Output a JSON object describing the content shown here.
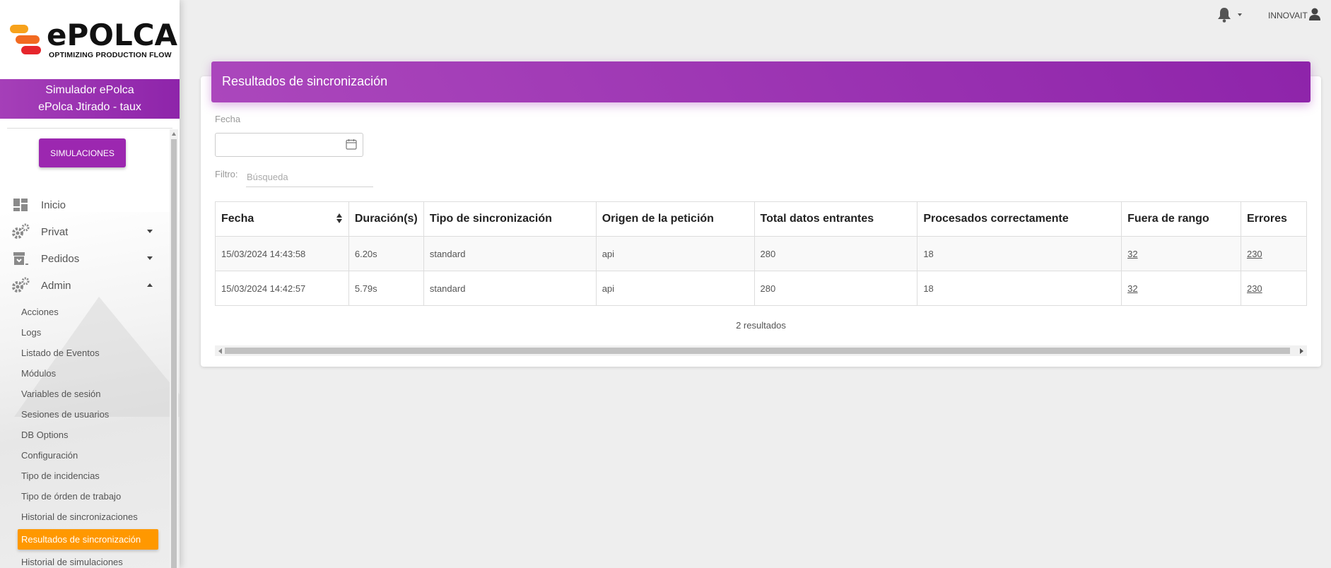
{
  "brand": {
    "name": "ePOLCA",
    "tagline": "OPTIMIZING PRODUCTION FLOW",
    "colors": {
      "orange": "#f7a21b",
      "red": "#e6262c",
      "purple": "#9c27b0",
      "active": "#ff9800"
    }
  },
  "user_panel": {
    "line1": "Simulador ePolca",
    "line2": "ePolca Jtirado - taux"
  },
  "sidebar": {
    "simulations_button": "SIMULACIONES",
    "nav": [
      {
        "label": "Inicio",
        "icon": "dashboard-icon"
      },
      {
        "label": "Privat",
        "icon": "gears-icon"
      },
      {
        "label": "Pedidos",
        "icon": "archive-icon"
      },
      {
        "label": "Admin",
        "icon": "gears-icon"
      }
    ],
    "admin_items": [
      "Acciones",
      "Logs",
      "Listado de Eventos",
      "Módulos",
      "Variables de sesión",
      "Sesiones de usuarios",
      "DB Options",
      "Configuración",
      "Tipo de incidencias",
      "Tipo de órden de trabajo",
      "Historial de sincronizaciones",
      "Resultados de sincronización",
      "Historial de simulaciones"
    ]
  },
  "topbar": {
    "user": "INNOVAIT"
  },
  "page": {
    "title": "Resultados de sincronización",
    "date_label": "Fecha",
    "date_value": "",
    "filter_label": "Filtro:",
    "search_placeholder": "Búsqueda"
  },
  "table": {
    "headers": [
      "Fecha",
      "Duración(s)",
      "Tipo de sincronización",
      "Origen de la petición",
      "Total datos entrantes",
      "Procesados correctamente",
      "Fuera de rango",
      "Errores"
    ],
    "rows": [
      [
        "15/03/2024 14:43:58",
        "6.20s",
        "standard",
        "api",
        "280",
        "18",
        "32",
        "230"
      ],
      [
        "15/03/2024 14:42:57",
        "5.79s",
        "standard",
        "api",
        "280",
        "18",
        "32",
        "230"
      ]
    ],
    "count_text": "2 resultados"
  }
}
